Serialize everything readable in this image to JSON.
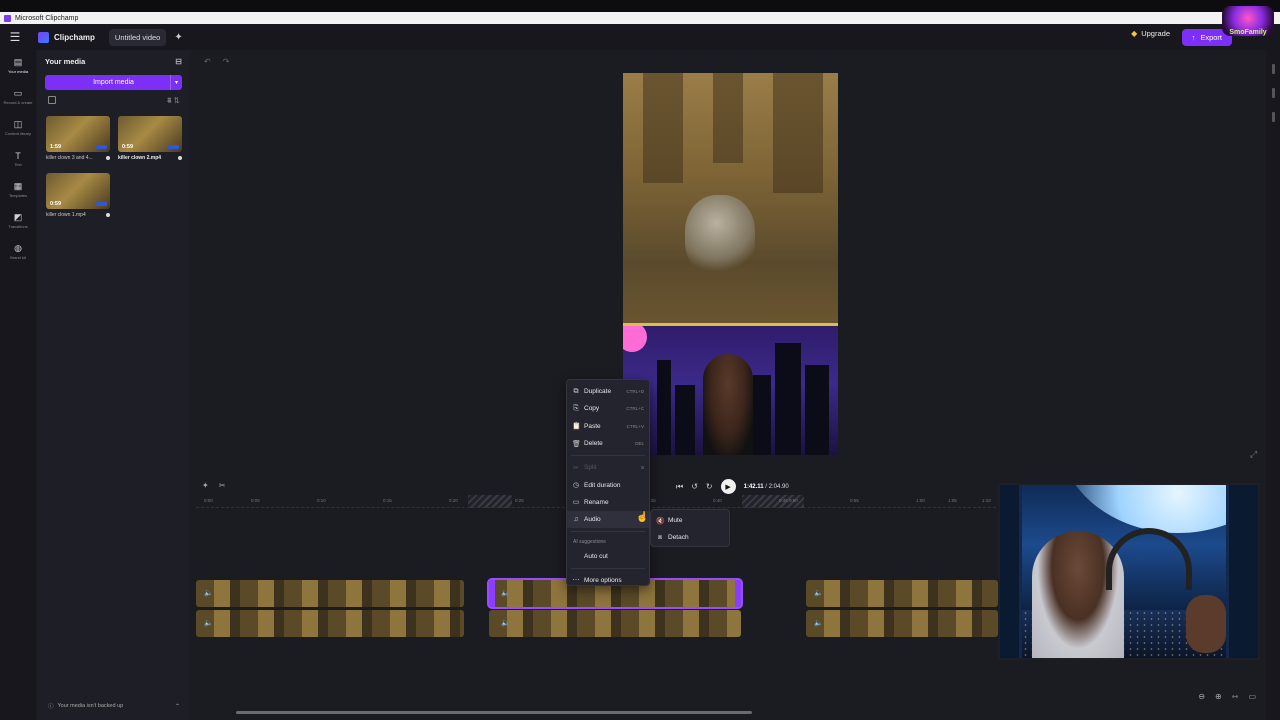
{
  "window": {
    "title": "Microsoft Clipchamp"
  },
  "appbar": {
    "brand": "Clipchamp",
    "project_name": "Untitled video",
    "upgrade_label": "Upgrade",
    "export_label": "Export"
  },
  "left_rail": {
    "items": [
      {
        "label": "Your media",
        "icon": "folder-icon"
      },
      {
        "label": "Record & create",
        "icon": "camera-icon"
      },
      {
        "label": "Content library",
        "icon": "library-icon"
      },
      {
        "label": "Text",
        "icon": "text-icon"
      },
      {
        "label": "Templates",
        "icon": "templates-icon"
      },
      {
        "label": "Transitions",
        "icon": "transitions-icon"
      },
      {
        "label": "Brand kit",
        "icon": "brand-kit-icon"
      }
    ]
  },
  "media_panel": {
    "title": "Your media",
    "import_label": "Import media",
    "items": [
      {
        "duration": "1:59",
        "name": "killer clown 3 and 4..."
      },
      {
        "duration": "0:59",
        "name": "killer clown 2.mp4"
      },
      {
        "duration": "0:59",
        "name": "killer clown 1.mp4"
      }
    ],
    "backup_notice": "Your media isn't backed up"
  },
  "player": {
    "current_time": "1:42.11",
    "total_time": "2:04.90"
  },
  "ruler": {
    "ticks": [
      "0:00",
      "0:05",
      "0:10",
      "0:15",
      "0:20",
      "0:25",
      "0:30",
      "0:35",
      "0:40",
      "0:45",
      "0:50",
      "0:55",
      "1:00",
      "1:05",
      "1:10"
    ]
  },
  "context_menu": {
    "items": [
      {
        "label": "Duplicate",
        "shortcut": "CTRL+D"
      },
      {
        "label": "Copy",
        "shortcut": "CTRL+C"
      },
      {
        "label": "Paste",
        "shortcut": "CTRL+V"
      },
      {
        "label": "Delete",
        "shortcut": "DEL"
      },
      {
        "label": "Split",
        "shortcut": "S"
      },
      {
        "label": "Edit duration",
        "shortcut": ""
      },
      {
        "label": "Rename",
        "shortcut": ""
      },
      {
        "label": "Audio",
        "shortcut": ""
      }
    ],
    "ai_section": "AI suggestions",
    "auto_cut": "Auto cut",
    "more_options": "More options"
  },
  "audio_submenu": {
    "items": [
      {
        "label": "Mute"
      },
      {
        "label": "Detach"
      }
    ]
  },
  "streamer_badge": {
    "text": "SmoFamily"
  },
  "colors": {
    "accent": "#7b2ff7",
    "background": "#1b1b22",
    "panel": "#1e1e26"
  }
}
